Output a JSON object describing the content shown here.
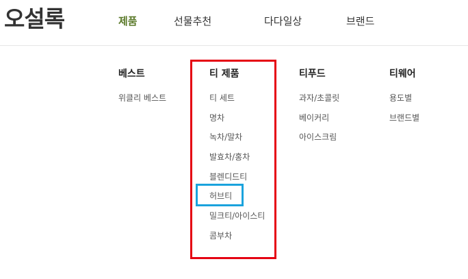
{
  "brand": {
    "logo_text": "오설록"
  },
  "nav": [
    {
      "label": "제품",
      "active": true
    },
    {
      "label": "선물추천",
      "active": false
    },
    {
      "label": "다다일상",
      "active": false
    },
    {
      "label": "브랜드",
      "active": false
    }
  ],
  "menu": {
    "columns": [
      {
        "heading": "베스트",
        "items": [
          "위클리 베스트"
        ]
      },
      {
        "heading": "티 제품",
        "items": [
          "티 세트",
          "명차",
          "녹차/말차",
          "발효차/홍차",
          "블렌디드티",
          "허브티",
          "밀크티/아이스티",
          "콤부차"
        ]
      },
      {
        "heading": "티푸드",
        "items": [
          "과자/초콜릿",
          "베이커리",
          "아이스크림"
        ]
      },
      {
        "heading": "티웨어",
        "items": [
          "용도별",
          "브랜드별"
        ]
      }
    ]
  },
  "colors": {
    "active_nav": "#5b7a2a",
    "highlight_red": "#e50012",
    "highlight_blue": "#1aa3dd"
  }
}
